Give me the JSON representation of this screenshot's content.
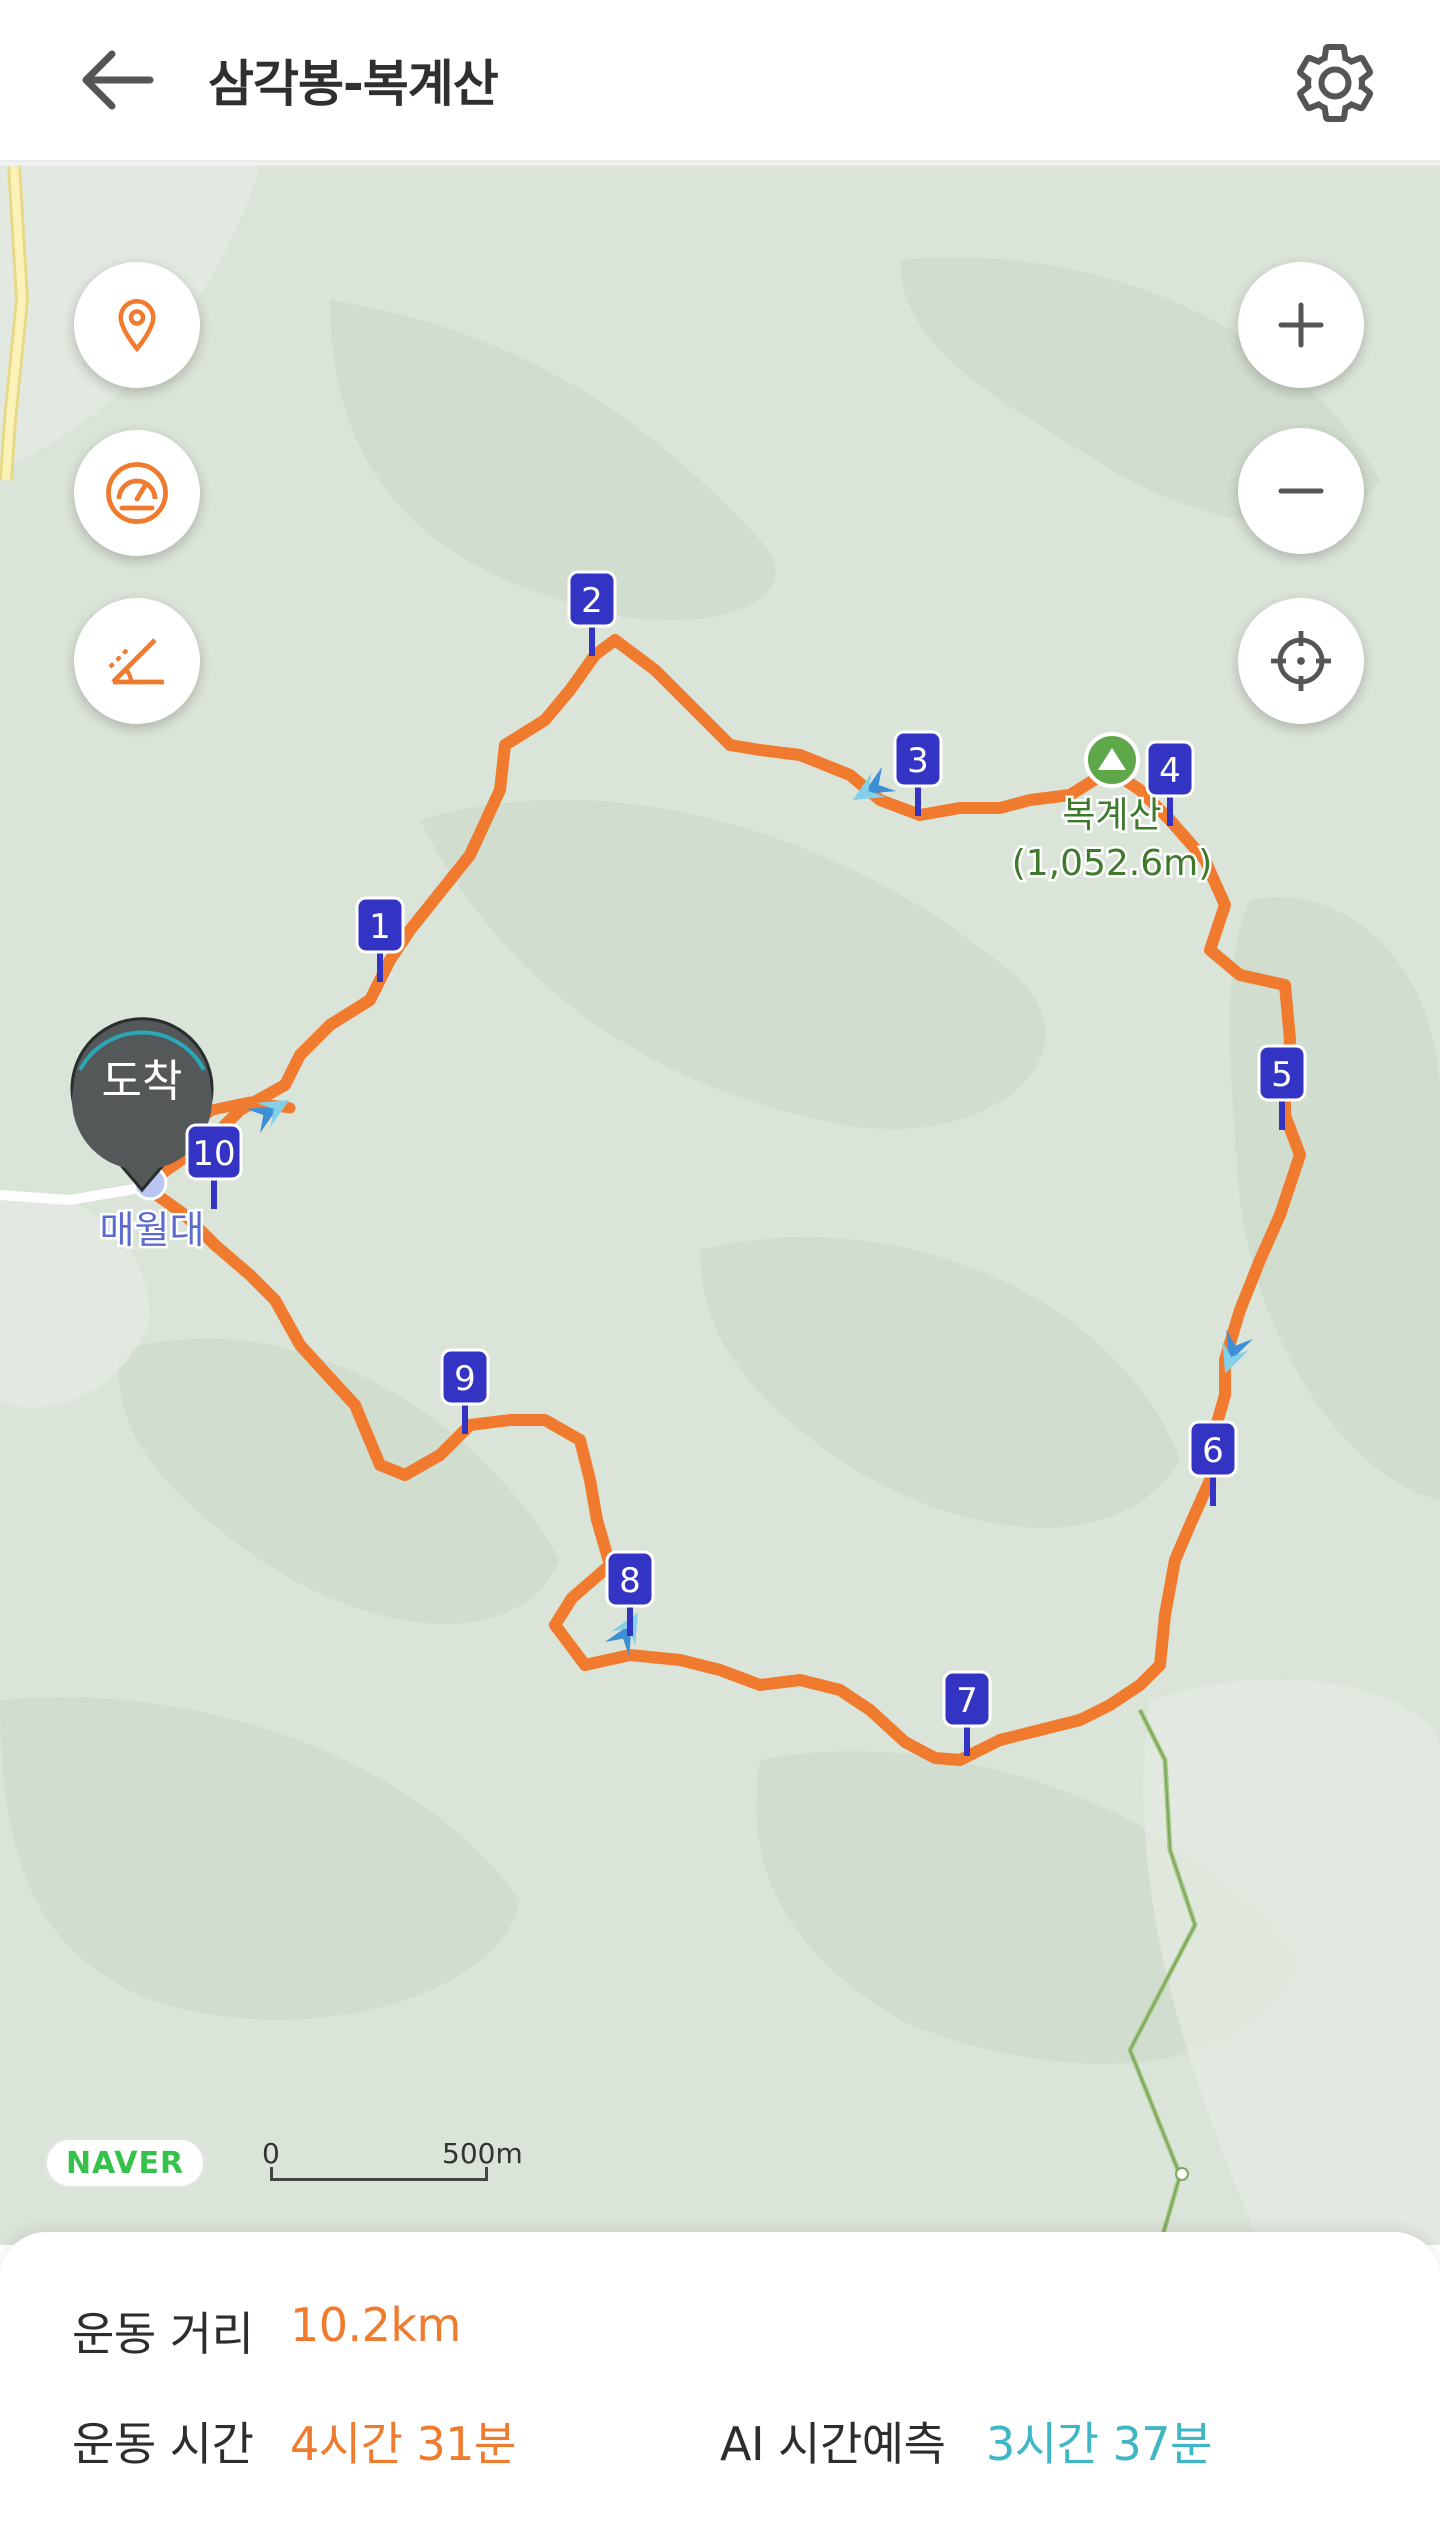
{
  "header": {
    "title": "삼각봉-복계산",
    "back_icon": "arrow-left-icon",
    "settings_icon": "gear-icon"
  },
  "map": {
    "left_controls": [
      "location-pin-icon",
      "speedometer-icon",
      "slope-angle-icon"
    ],
    "right_controls": [
      "zoom-in-icon",
      "zoom-out-icon",
      "crosshair-icon"
    ],
    "arrival_marker": "도착",
    "places": [
      {
        "name": "매월대"
      },
      {
        "name": "복계산",
        "elevation": "(1,052.6m)"
      }
    ],
    "waypoints": [
      "1",
      "2",
      "3",
      "4",
      "5",
      "6",
      "7",
      "8",
      "9",
      "10"
    ],
    "provider": "NAVER",
    "scale": {
      "start": "0",
      "end": "500m"
    },
    "route_color": "#f07b2f",
    "waypoint_color": "#3434c4"
  },
  "stats": {
    "distance_label": "운동 거리",
    "distance_value": "10.2km",
    "time_label": "운동 시간",
    "time_value": "4시간 31분",
    "ai_label": "AI 시간예측",
    "ai_value": "3시간 37분"
  }
}
